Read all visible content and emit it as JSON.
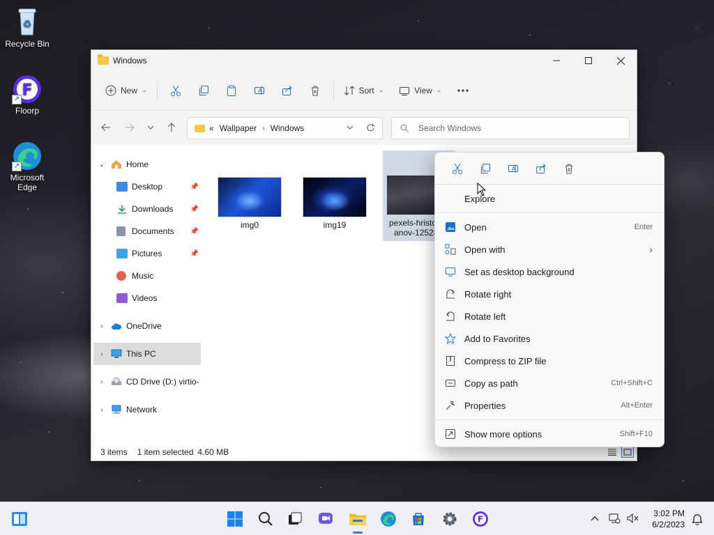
{
  "desktop": {
    "icons": [
      {
        "label": "Recycle Bin"
      },
      {
        "label": "Floorp"
      },
      {
        "label": "Microsoft Edge"
      }
    ]
  },
  "window": {
    "title": "Windows",
    "toolbar": {
      "new_label": "New",
      "sort_label": "Sort",
      "view_label": "View"
    },
    "address": {
      "overflow": "«",
      "crumbs": [
        "Wallpaper",
        "Windows"
      ]
    },
    "search": {
      "placeholder": "Search Windows"
    },
    "nav": {
      "home": "Home",
      "quick": [
        {
          "label": "Desktop",
          "color": "#3b8ae6"
        },
        {
          "label": "Downloads",
          "color": "#2e9b5b"
        },
        {
          "label": "Documents",
          "color": "#8a94a6"
        },
        {
          "label": "Pictures",
          "color": "#3aa2e8"
        },
        {
          "label": "Music",
          "color": "#e0674f"
        },
        {
          "label": "Videos",
          "color": "#8d5bd6"
        }
      ],
      "onedrive": "OneDrive",
      "this_pc": "This PC",
      "cd_drive": "CD Drive (D:) virtio-",
      "network": "Network"
    },
    "files": [
      {
        "name": "img0"
      },
      {
        "name": "img19"
      },
      {
        "name_line1": "pexels-hristo",
        "name_line2": "anov-12528"
      }
    ],
    "status": {
      "items": "3 items",
      "selected": "1 item selected",
      "size": "4.60 MB"
    }
  },
  "context_menu": {
    "items": [
      {
        "label": "Explore",
        "shortcut": ""
      },
      {
        "label": "Open",
        "shortcut": "Enter"
      },
      {
        "label": "Open with",
        "shortcut": "›"
      },
      {
        "label": "Set as desktop background",
        "shortcut": ""
      },
      {
        "label": "Rotate right",
        "shortcut": ""
      },
      {
        "label": "Rotate left",
        "shortcut": ""
      },
      {
        "label": "Add to Favorites",
        "shortcut": ""
      },
      {
        "label": "Compress to ZIP file",
        "shortcut": ""
      },
      {
        "label": "Copy as path",
        "shortcut": "Ctrl+Shift+C"
      },
      {
        "label": "Properties",
        "shortcut": "Alt+Enter"
      },
      {
        "label": "Show more options",
        "shortcut": "Shift+F10"
      }
    ]
  },
  "taskbar": {
    "time": "3:02 PM",
    "date": "6/2/2023"
  }
}
